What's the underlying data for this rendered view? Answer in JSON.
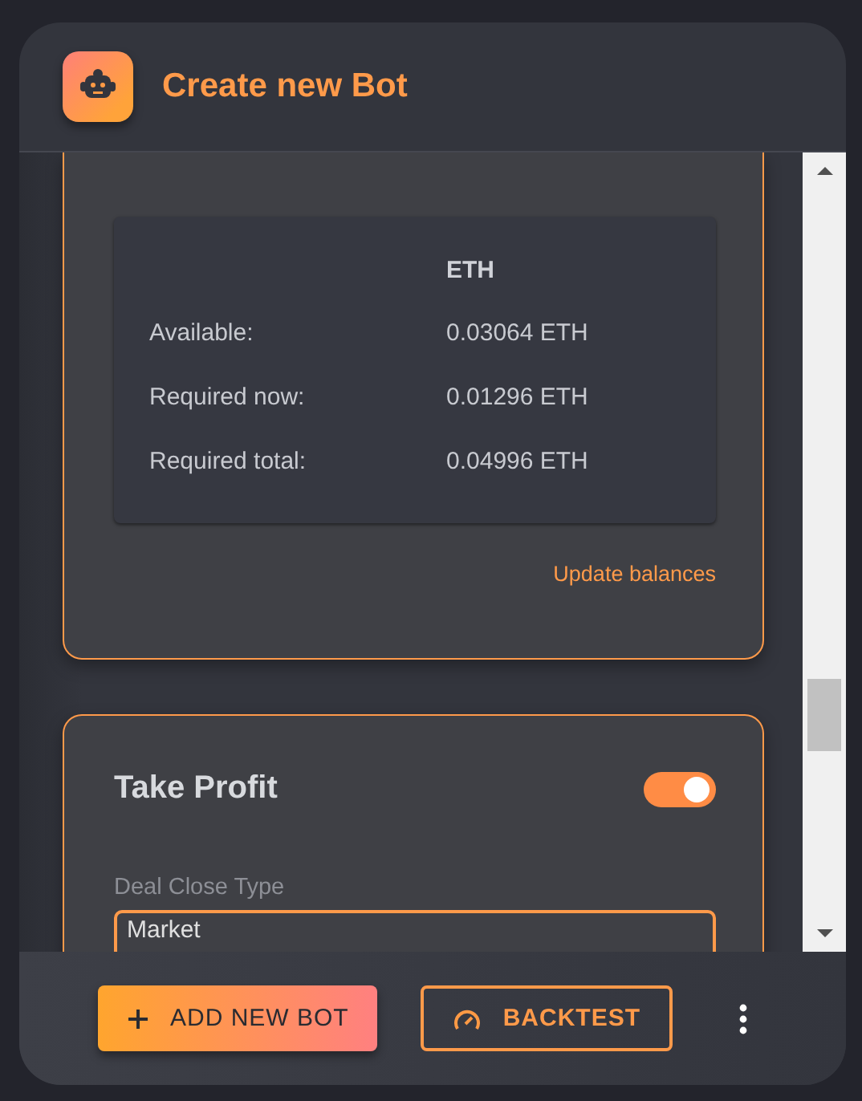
{
  "window": {
    "title": "Create new Bot"
  },
  "balances": {
    "column_header": "ETH",
    "rows": [
      {
        "label": "Available:",
        "value": "0.03064 ETH"
      },
      {
        "label": "Required now:",
        "value": "0.01296 ETH"
      },
      {
        "label": "Required total:",
        "value": "0.04996 ETH"
      }
    ],
    "update_link": "Update balances"
  },
  "take_profit": {
    "title": "Take Profit",
    "on": true,
    "deal_close_type": {
      "label": "Deal Close Type",
      "value": "Market"
    }
  },
  "footer": {
    "buttons": [
      {
        "kind": "primary",
        "label": "ADD NEW BOT"
      },
      {
        "kind": "outline",
        "label": "BACKTEST"
      }
    ]
  }
}
